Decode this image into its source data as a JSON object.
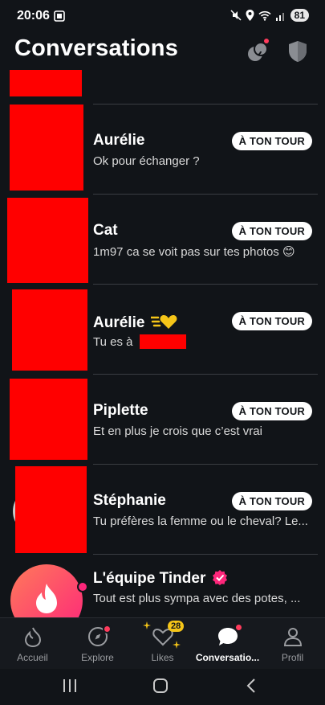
{
  "status_bar": {
    "time": "20:06",
    "battery": "81"
  },
  "header": {
    "title": "Conversations"
  },
  "conversations": [
    {
      "name": "Aurélie",
      "message": "Ok pour échanger ?",
      "badge": "À TON TOUR"
    },
    {
      "name": "Cat",
      "message": "1m97 ca se voit pas sur tes photos 😊",
      "badge": "À TON TOUR"
    },
    {
      "name": "Aurélie",
      "message": "Tu es à",
      "badge": "À TON TOUR"
    },
    {
      "name": "Piplette",
      "message": "Et en plus je crois que c’est vrai",
      "badge": "À TON TOUR"
    },
    {
      "name": "Stéphanie",
      "message": "Tu préfères la femme ou le cheval? Le...",
      "badge": "À TON TOUR"
    },
    {
      "name": "L'équipe Tinder",
      "message": "Tout est plus sympa avec des potes, ..."
    }
  ],
  "tabs": [
    {
      "label": "Accueil"
    },
    {
      "label": "Explore"
    },
    {
      "label": "Likes",
      "badge": "28"
    },
    {
      "label": "Conversatio..."
    },
    {
      "label": "Profil"
    }
  ],
  "colors": {
    "background": "#111418",
    "accent": "#ff3b5c",
    "badge_bg": "#ffffff",
    "likes_badge": "#f5c518"
  }
}
